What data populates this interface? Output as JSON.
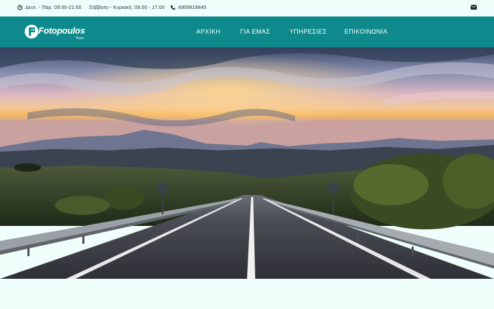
{
  "topbar": {
    "hours": "Δευτ. - Παρ. 09:00-21:00",
    "weekend": "Σάββατο - Κυριακή. 09.00 - 17.00",
    "phone": "6909618845",
    "clock_icon": "clock-icon",
    "phone_icon": "phone-icon",
    "mail_icon": "envelope-icon"
  },
  "brand": {
    "name": "Fotopoulos",
    "sub": "Tours"
  },
  "nav": {
    "items": [
      {
        "label": "ΑΡΧΙΚΗ"
      },
      {
        "label": "ΓΙΑ ΕΜΑΣ"
      },
      {
        "label": "ΥΠΗΡΕΣΙΕΣ"
      },
      {
        "label": "ΕΠΙΚΟΙΝΩΝΙΑ"
      }
    ]
  },
  "colors": {
    "navbar": "#0e8a8c",
    "background": "#effdfb"
  },
  "hero": {
    "image": "sunset-road-photo"
  }
}
